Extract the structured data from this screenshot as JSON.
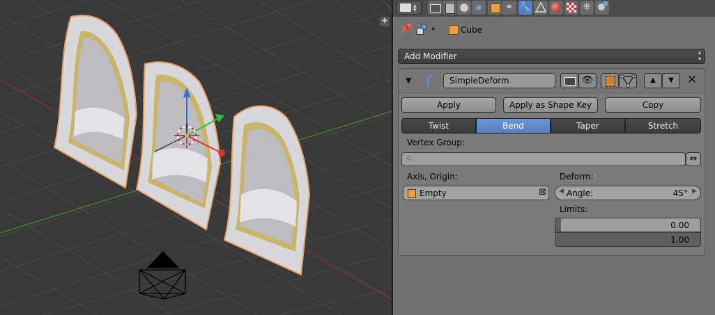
{
  "viewport": {
    "objects": [
      "arched-panel",
      "arched-panel",
      "arched-panel"
    ],
    "camera": "camera-wireframe",
    "cursor": "3d-cursor"
  },
  "properties": {
    "tabs": [
      "render-tab",
      "render-layers-tab",
      "scene-tab",
      "world-tab",
      "object-tab",
      "constraints-tab",
      "modifiers-tab",
      "data-tab",
      "material-tab",
      "texture-tab",
      "particles-tab",
      "physics-tab"
    ],
    "breadcrumb": {
      "object": "Cube"
    },
    "add_modifier": "Add Modifier",
    "modifier": {
      "name": "SimpleDeform",
      "apply_label": "Apply",
      "apply_shape_key_label": "Apply as Shape Key",
      "copy_label": "Copy",
      "modes": [
        "Twist",
        "Bend",
        "Taper",
        "Stretch"
      ],
      "active_mode": "Bend",
      "vertex_group_label": "Vertex Group:",
      "vertex_group_value": "",
      "axis_origin_label": "Axis, Origin:",
      "axis_origin_value": "Empty",
      "deform_label": "Deform:",
      "angle_label": "Angle:",
      "angle_value": "45°",
      "limits_label": "Limits:",
      "limit_min": "0.00",
      "limit_max": "1.00",
      "limit_min_fraction": 0.0,
      "limit_max_fraction": 1.0
    }
  },
  "colors": {
    "active_tab": "#5680c4",
    "selection_outline": "#f0a050",
    "panel_bg": "#727272",
    "viewport_bg": "#393939"
  }
}
